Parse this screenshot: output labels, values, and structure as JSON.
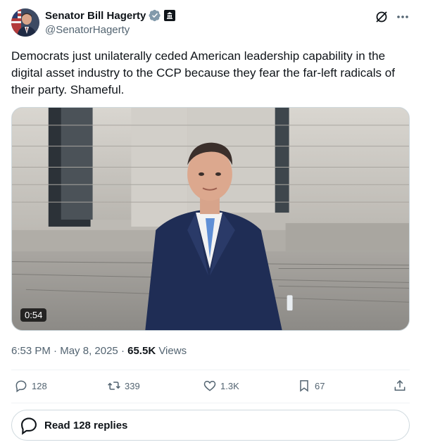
{
  "author": {
    "display_name": "Senator Bill Hagerty",
    "handle": "@SenatorHagerty",
    "verified_color": "#829aab",
    "icons": {
      "verified": "verified-badge-icon",
      "affiliation": "government-building-icon"
    }
  },
  "tweet": {
    "text": "Democrats just unilaterally ceded American leadership capability in the digital asset industry to the CCP because they fear the far-left radicals of their party. Shameful."
  },
  "media": {
    "type": "video",
    "duration": "0:54"
  },
  "meta": {
    "time": "6:53 PM",
    "date": "May 8, 2025",
    "separator": "·",
    "views_count": "65.5K",
    "views_label": "Views"
  },
  "actions": {
    "replies": "128",
    "reposts": "339",
    "likes": "1.3K",
    "bookmarks": "67"
  },
  "replies_button": {
    "label": "Read 128 replies"
  },
  "colors": {
    "text": "#0f1419",
    "secondary": "#536471",
    "border": "#cfd9de"
  }
}
